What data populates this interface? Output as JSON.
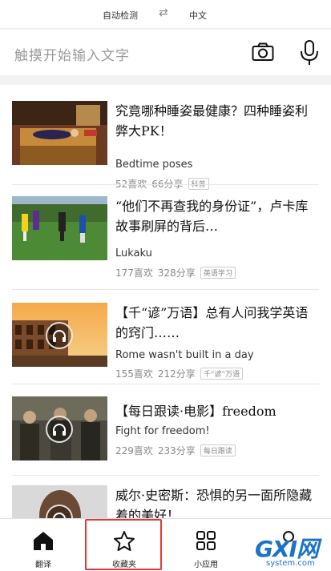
{
  "lang_bar": {
    "source": "自动检测",
    "swap_icon": "swap-icon",
    "target": "中文"
  },
  "input": {
    "placeholder": "触摸开始输入文字",
    "camera_icon": "camera-icon",
    "mic_icon": "microphone-icon"
  },
  "cards": [
    {
      "title": "究竟哪种睡姿最健康？四种睡姿利弊大PK！",
      "subtitle": "Bedtime poses",
      "likes": "52喜欢",
      "shares": "66分享",
      "tag": "科普",
      "has_play": false
    },
    {
      "title": "“他们不再查我的身份证”，卢卡库故事刷屏的背后…",
      "subtitle": "Lukaku",
      "likes": "177喜欢",
      "shares": "328分享",
      "tag": "英语学习",
      "has_play": false
    },
    {
      "title": "【千“谚”万语】总有人问我学英语的窍门……",
      "subtitle": "Rome wasn't built in a day",
      "likes": "155喜欢",
      "shares": "212分享",
      "tag": "千“谚”万语",
      "has_play": true
    },
    {
      "title": "【每日跟读·电影】freedom",
      "subtitle": "Fight for freedom!",
      "likes": "229喜欢",
      "shares": "233分享",
      "tag": "每日跟读",
      "has_play": true
    },
    {
      "title": "威尔·史密斯：恐惧的另一面所隐藏着的美好！",
      "subtitle": "",
      "likes": "",
      "shares": "",
      "tag": "",
      "has_play": true
    }
  ],
  "tabs": [
    {
      "label": "翻译",
      "icon": "home-icon"
    },
    {
      "label": "收藏夹",
      "icon": "star-icon"
    },
    {
      "label": "小应用",
      "icon": "apps-grid-icon"
    },
    {
      "label": "",
      "icon": "profile-icon"
    }
  ],
  "watermark": {
    "main": "GXI网",
    "sub": "system.com"
  },
  "colors": {
    "highlight": "#e53935",
    "watermark": "#1a73c8"
  }
}
